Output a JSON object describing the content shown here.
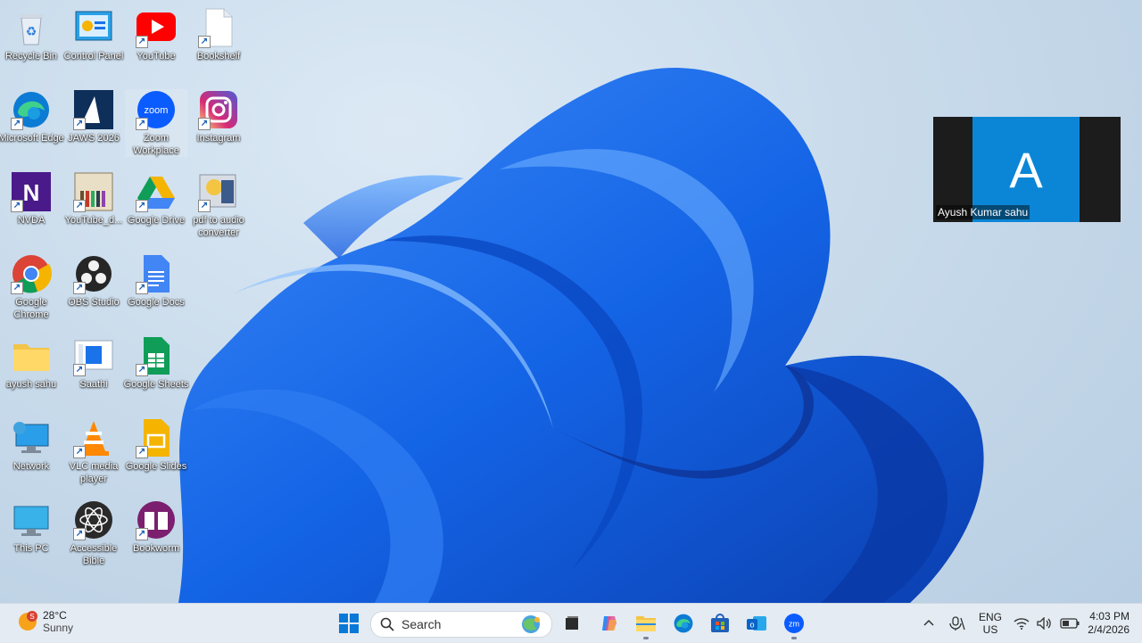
{
  "desktop": {
    "icons": [
      {
        "label": "Recycle Bin",
        "icon": "recycle-bin-icon"
      },
      {
        "label": "Control Panel",
        "icon": "control-panel-icon"
      },
      {
        "label": "YouTube",
        "icon": "youtube-icon"
      },
      {
        "label": "Bookshelf",
        "icon": "file-icon"
      },
      {
        "label": "Microsoft Edge",
        "icon": "edge-icon"
      },
      {
        "label": "JAWS 2026",
        "icon": "jaws-icon"
      },
      {
        "label": "Zoom Workplace",
        "icon": "zoom-icon"
      },
      {
        "label": "Instagram",
        "icon": "instagram-icon"
      },
      {
        "label": "NVDA",
        "icon": "nvda-icon"
      },
      {
        "label": "YouTube_d...",
        "icon": "youtube-downloader-icon"
      },
      {
        "label": "Google Drive",
        "icon": "google-drive-icon"
      },
      {
        "label": "pdf to audio converter",
        "icon": "pdf-audio-icon"
      },
      {
        "label": "Google Chrome",
        "icon": "chrome-icon"
      },
      {
        "label": "OBS Studio",
        "icon": "obs-icon"
      },
      {
        "label": "Google Docs",
        "icon": "google-docs-icon"
      },
      {
        "label": "ayush sahu",
        "icon": "folder-icon"
      },
      {
        "label": "Saathi",
        "icon": "saathi-icon"
      },
      {
        "label": "Google Sheets",
        "icon": "google-sheets-icon"
      },
      {
        "label": "Network",
        "icon": "network-icon"
      },
      {
        "label": "VLC media player",
        "icon": "vlc-icon"
      },
      {
        "label": "Google Slides",
        "icon": "google-slides-icon"
      },
      {
        "label": "This PC",
        "icon": "this-pc-icon"
      },
      {
        "label": "Accessible Bible",
        "icon": "accessible-bible-icon"
      },
      {
        "label": "Bookworm",
        "icon": "bookworm-icon"
      }
    ]
  },
  "zoom_tile": {
    "letter": "A",
    "name": "Ayush Kumar sahu"
  },
  "taskbar": {
    "weather": {
      "temp": "28°C",
      "condition": "Sunny",
      "badge": "S"
    },
    "search_label": "Search",
    "language": {
      "line1": "ENG",
      "line2": "US"
    },
    "clock": {
      "time": "4:03 PM",
      "date": "2/4/2026"
    }
  },
  "colors": {
    "accent": "#0067c0",
    "wallpaper_bloom": "#1565e0",
    "zoom_blue": "#0b86d6"
  }
}
